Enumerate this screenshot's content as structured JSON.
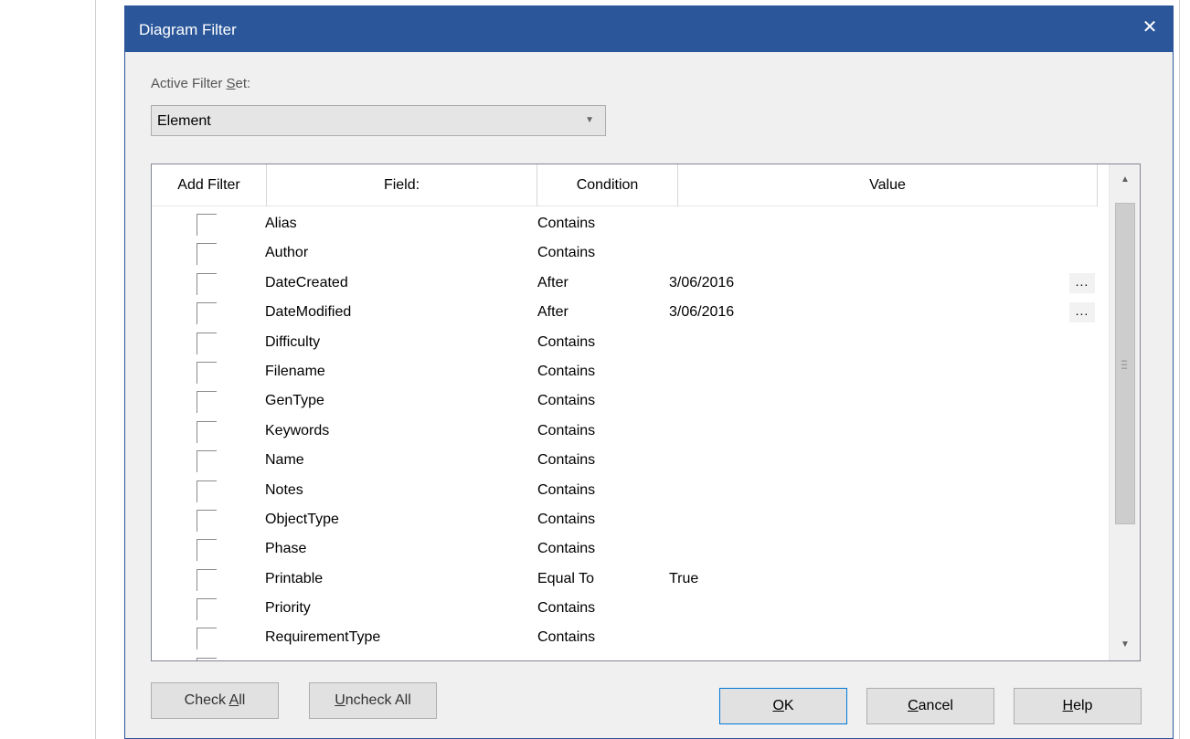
{
  "dialog": {
    "title": "Diagram Filter",
    "close_glyph": "✕"
  },
  "filter_set": {
    "label_pre": "Active Filter ",
    "label_mnemonic": "S",
    "label_post": "et:",
    "selected": "Element"
  },
  "grid": {
    "headers": [
      "Add Filter",
      "Field:",
      "Condition",
      "Value"
    ],
    "rows": [
      {
        "field": "Alias",
        "condition": "Contains",
        "value": "",
        "ellipsis": "",
        "checked": false
      },
      {
        "field": "Author",
        "condition": "Contains",
        "value": "",
        "ellipsis": "",
        "checked": false
      },
      {
        "field": "DateCreated",
        "condition": "After",
        "value": "3/06/2016",
        "ellipsis": "...",
        "checked": false
      },
      {
        "field": "DateModified",
        "condition": "After",
        "value": "3/06/2016",
        "ellipsis": "...",
        "checked": false
      },
      {
        "field": "Difficulty",
        "condition": "Contains",
        "value": "",
        "ellipsis": "",
        "checked": false
      },
      {
        "field": "Filename",
        "condition": "Contains",
        "value": "",
        "ellipsis": "",
        "checked": false
      },
      {
        "field": "GenType",
        "condition": "Contains",
        "value": "",
        "ellipsis": "",
        "checked": false
      },
      {
        "field": "Keywords",
        "condition": "Contains",
        "value": "",
        "ellipsis": "",
        "checked": false
      },
      {
        "field": "Name",
        "condition": "Contains",
        "value": "",
        "ellipsis": "",
        "checked": false
      },
      {
        "field": "Notes",
        "condition": "Contains",
        "value": "",
        "ellipsis": "",
        "checked": false
      },
      {
        "field": "ObjectType",
        "condition": "Contains",
        "value": "",
        "ellipsis": "",
        "checked": false
      },
      {
        "field": "Phase",
        "condition": "Contains",
        "value": "",
        "ellipsis": "",
        "checked": false
      },
      {
        "field": "Printable",
        "condition": "Equal To",
        "value": "True",
        "ellipsis": "",
        "checked": false
      },
      {
        "field": "Priority",
        "condition": "Contains",
        "value": "",
        "ellipsis": "",
        "checked": false
      },
      {
        "field": "RequirementType",
        "condition": "Contains",
        "value": "",
        "ellipsis": "",
        "checked": false
      }
    ]
  },
  "buttons": {
    "check_all_pre": "Check ",
    "check_all_mn": "A",
    "check_all_post": "ll",
    "uncheck_all_mn": "U",
    "uncheck_all_post": "ncheck All",
    "ok_mn": "O",
    "ok_post": "K",
    "cancel_mn": "C",
    "cancel_post": "ancel",
    "help_mn": "H",
    "help_post": "elp"
  },
  "icons": {
    "dropdown": "chevron-down-icon",
    "scroll_up": "arrow-up-icon",
    "scroll_down": "arrow-down-icon"
  }
}
